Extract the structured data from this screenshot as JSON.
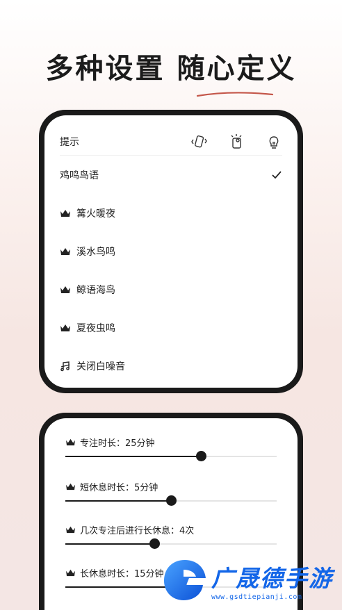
{
  "headline": "多种设置 随心定义",
  "tips_panel": {
    "label": "提示",
    "icons": [
      "vibrate-phone-icon",
      "flash-phone-icon",
      "bulb-icon"
    ]
  },
  "sounds": [
    {
      "label": "鸡鸣鸟语",
      "premium": false,
      "selected": true
    },
    {
      "label": "篝火暖夜",
      "premium": true,
      "selected": false
    },
    {
      "label": "溪水鸟鸣",
      "premium": true,
      "selected": false
    },
    {
      "label": "鲸语海鸟",
      "premium": true,
      "selected": false
    },
    {
      "label": "夏夜虫鸣",
      "premium": true,
      "selected": false
    },
    {
      "label": "关闭白噪音",
      "premium": false,
      "selected": false
    }
  ],
  "settings": [
    {
      "label": "专注时长：25分钟",
      "value": 0.64
    },
    {
      "label": "短休息时长：5分钟",
      "value": 0.5
    },
    {
      "label": "几次专注后进行长休息：4次",
      "value": 0.42
    },
    {
      "label": "长休息时长：15分钟",
      "value": 0.55
    }
  ],
  "watermark": {
    "title": "广晟德手游",
    "url": "www.gsdtiepianji.com",
    "accent": "#1366e8"
  }
}
